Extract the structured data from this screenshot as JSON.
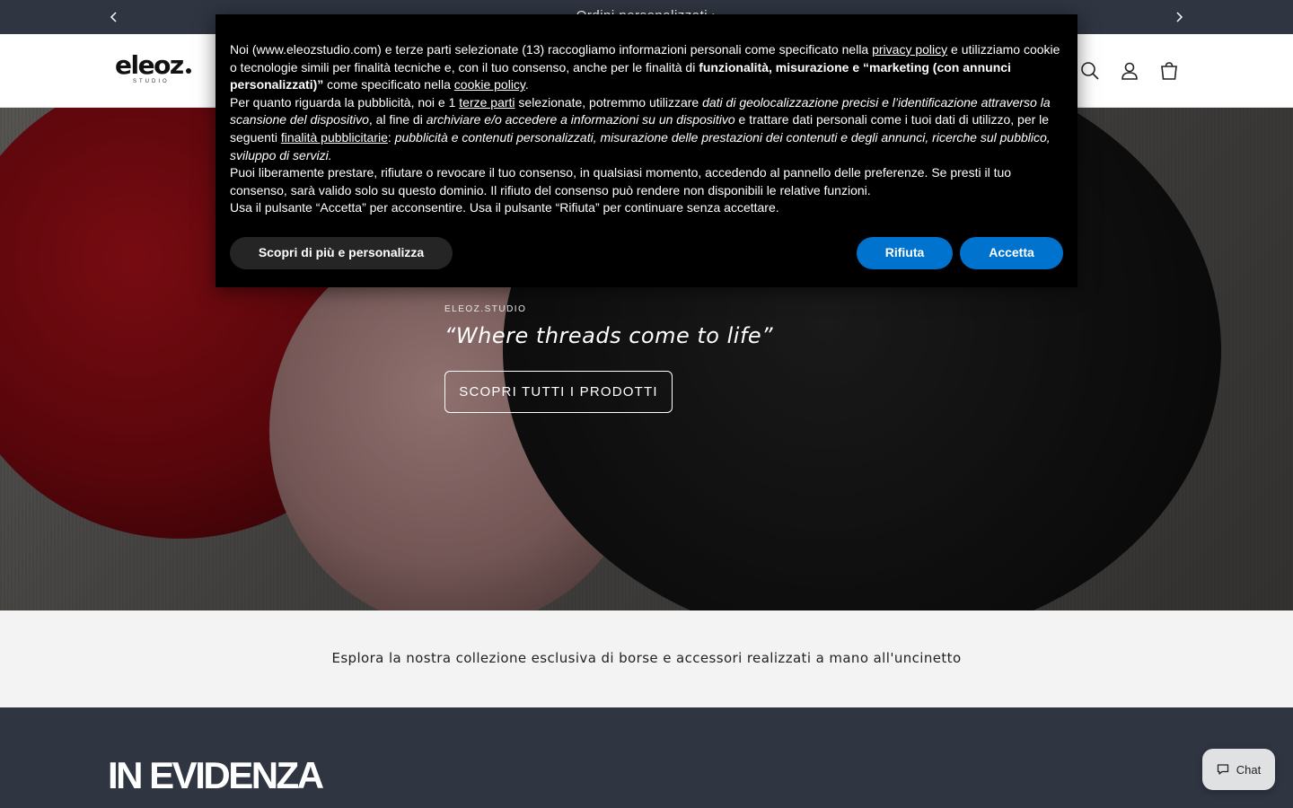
{
  "announcement": {
    "text": "Ordini personalizzati ›",
    "prev_icon": "chevron-left-icon",
    "next_icon": "chevron-right-icon"
  },
  "header": {
    "logo_text": "eleoz",
    "logo_sub": "STUDIO",
    "icons": [
      "search-icon",
      "account-icon",
      "cart-icon"
    ]
  },
  "hero": {
    "eyebrow": "ELEOZ.STUDIO",
    "tagline": "“Where threads come to life”",
    "cta_label": "SCOPRI TUTTI I PRODOTTI"
  },
  "intro": {
    "text": "Esplora la nostra collezione esclusiva di borse e accessori realizzati a mano all'uncinetto"
  },
  "featured": {
    "heading": "IN EVIDENZA"
  },
  "chat": {
    "label": "Chat"
  },
  "cookie_banner": {
    "p1_a": "Noi (www.eleozstudio.com) e terze parti selezionate (13) raccogliamo informazioni personali come specificato nella ",
    "privacy_link": "privacy policy",
    "p1_b": " e utilizziamo cookie o tecnologie simili per finalità tecniche e, con il tuo consenso, anche per le finalità di ",
    "p1_bold": "funzionalità, misurazione e “marketing (con annunci personalizzati)”",
    "p1_c": " come specificato nella ",
    "cookie_link": "cookie policy",
    "p1_d": ".",
    "p2_a": "Per quanto riguarda la pubblicità, noi e 1 ",
    "third_parties_link": "terze parti",
    "p2_b": " selezionate, potremmo utilizzare ",
    "p2_i1": "dati di geolocalizzazione precisi e l’identificazione attraverso la scansione del dispositivo",
    "p2_c": ", al fine di ",
    "p2_i2": "archiviare e/o accedere a informazioni su un dispositivo",
    "p2_d": " e trattare dati personali come i tuoi dati di utilizzo, per le seguenti ",
    "ad_purposes_link": "finalità pubblicitarie",
    "p2_e": ": ",
    "p2_i3": "pubblicità e contenuti personalizzati, misurazione delle prestazioni dei contenuti e degli annunci, ricerche sul pubblico, sviluppo di servizi.",
    "p3": "Puoi liberamente prestare, rifiutare o revocare il tuo consenso, in qualsiasi momento, accedendo al pannello delle preferenze. Se presti il tuo consenso, sarà valido solo su questo dominio. Il rifiuto del consenso può rendere non disponibili le relative funzioni.",
    "p4": "Usa il pulsante “Accetta” per acconsentire. Usa il pulsante “Rifiuta” per continuare senza accettare.",
    "btn_more": "Scopri di più e personalizza",
    "btn_reject": "Rifiuta",
    "btn_accept": "Accetta",
    "accent_color": "#0073ce"
  }
}
